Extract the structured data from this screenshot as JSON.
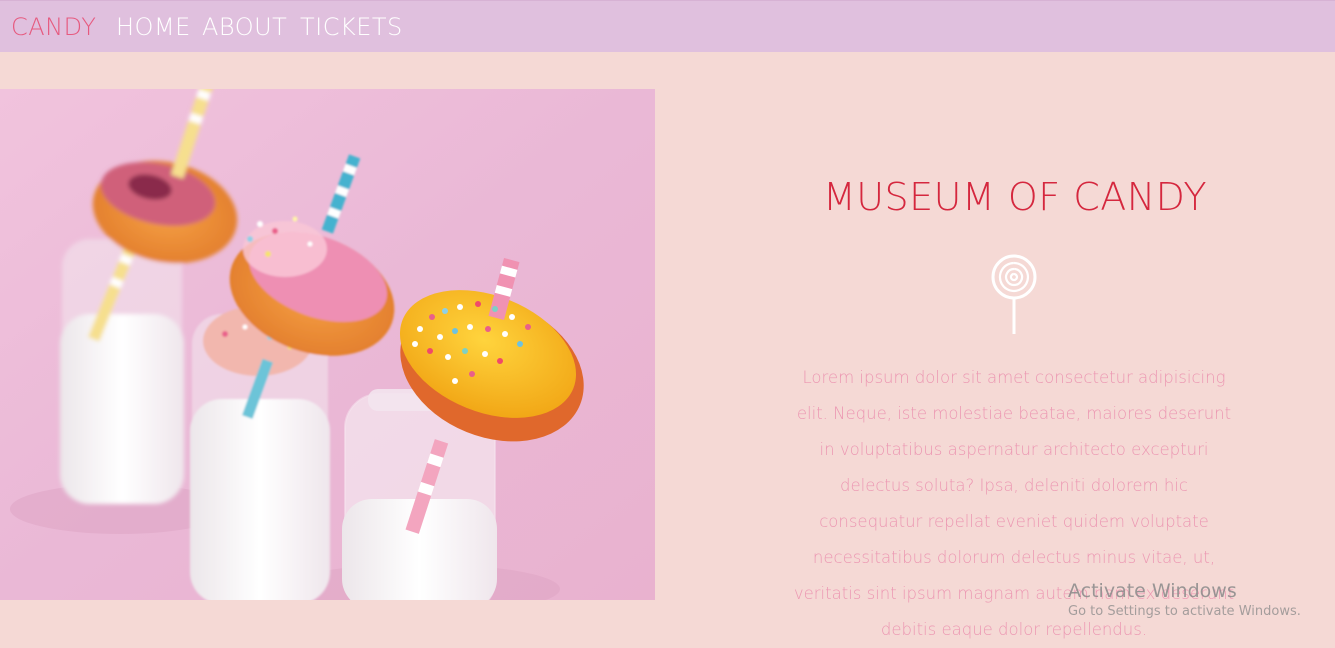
{
  "nav": {
    "brand": "CANDY",
    "items": [
      "HOME",
      "ABOUT",
      "TICKETS"
    ]
  },
  "hero": {
    "image_alt": "Donuts on milk bottles with striped straws",
    "title": "MUSEUM OF CANDY",
    "icon": "lollipop-icon",
    "body": "Lorem ipsum dolor sit amet consectetur adipisicing elit. Neque, iste molestiae beatae, maiores deserunt in voluptatibus aspernatur architecto excepturi delectus soluta? Ipsa, deleniti dolorem hic consequatur repellat eveniet quidem voluptate necessitatibus dolorum delectus minus vitae, ut, veritatis sint ipsum magnam autem nam ex deserunt debitis eaque dolor repellendus."
  },
  "watermark": {
    "title": "Activate Windows",
    "subtitle": "Go to Settings to activate Windows."
  },
  "colors": {
    "page_bg": "#f5d9d5",
    "navbar_bg": "#e0c0de",
    "brand": "#e65a7f",
    "title": "#d5273e",
    "body_text": "#ec97b2"
  }
}
